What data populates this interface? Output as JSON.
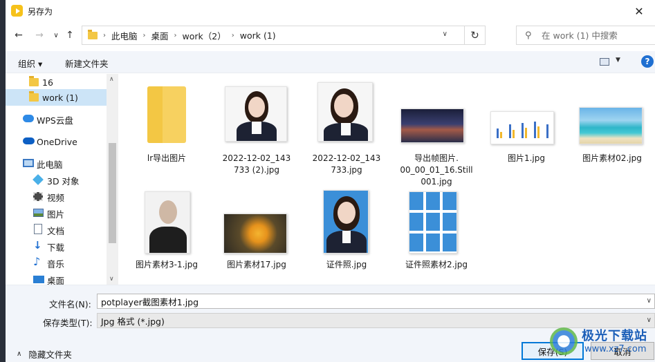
{
  "window": {
    "title": "另存为",
    "close_glyph": "✕"
  },
  "nav": {
    "back": "←",
    "forward": "→",
    "recent": "∨",
    "up": "↑",
    "breadcrumbs": [
      "此电脑",
      "桌面",
      "work（2）",
      "work (1)"
    ],
    "refresh": "↻",
    "search_placeholder": "在 work (1) 中搜索"
  },
  "toolbar": {
    "organize": "组织 ▾",
    "new_folder": "新建文件夹",
    "help": "?"
  },
  "sidebar": {
    "items": [
      {
        "label": "16",
        "icon": "folder-icon"
      },
      {
        "label": "work (1)",
        "icon": "folder-icon",
        "selected": true
      },
      {
        "label": "WPS云盘",
        "icon": "cloud-icon"
      },
      {
        "label": "OneDrive",
        "icon": "onedrive-icon"
      },
      {
        "label": "此电脑",
        "icon": "computer-icon"
      },
      {
        "label": "3D 对象",
        "icon": "cube-icon"
      },
      {
        "label": "视频",
        "icon": "video-icon"
      },
      {
        "label": "图片",
        "icon": "picture-icon"
      },
      {
        "label": "文档",
        "icon": "document-icon"
      },
      {
        "label": "下载",
        "icon": "download-icon"
      },
      {
        "label": "音乐",
        "icon": "music-icon"
      },
      {
        "label": "桌面",
        "icon": "desktop-icon"
      }
    ]
  },
  "files": [
    {
      "name": "lr导出图片",
      "type": "folder"
    },
    {
      "name": "2022-12-02_143733 (2).jpg",
      "type": "portrait"
    },
    {
      "name": "2022-12-02_143733.jpg",
      "type": "portrait"
    },
    {
      "name": "导出帧图片.00_00_01_16.Still001.jpg",
      "type": "city"
    },
    {
      "name": "图片1.jpg",
      "type": "chart"
    },
    {
      "name": "图片素材02.jpg",
      "type": "beach"
    },
    {
      "name": "图片素材3-1.jpg",
      "type": "elder"
    },
    {
      "name": "图片素材17.jpg",
      "type": "leaf"
    },
    {
      "name": "证件照.jpg",
      "type": "idphoto"
    },
    {
      "name": "证件照素材2.jpg",
      "type": "idgrid"
    }
  ],
  "file_lines": [
    [
      "lr导出图片"
    ],
    [
      "2022-12-02_143",
      "733 (2).jpg"
    ],
    [
      "2022-12-02_143",
      "733.jpg"
    ],
    [
      "导出帧图片.",
      "00_00_01_16.Still",
      "001.jpg"
    ],
    [
      "图片1.jpg"
    ],
    [
      "图片素材02.jpg"
    ],
    [
      "图片素材3-1.jpg"
    ],
    [
      "图片素材17.jpg"
    ],
    [
      "证件照.jpg"
    ],
    [
      "证件照素材2.jpg"
    ]
  ],
  "form": {
    "filename_label": "文件名(N):",
    "filename_value": "potplayer截图素材1.jpg",
    "filetype_label": "保存类型(T):",
    "filetype_value": "Jpg 格式 (*.jpg)"
  },
  "footer": {
    "hide_folders": "隐藏文件夹",
    "save": "保存(S)",
    "cancel": "取消"
  },
  "watermark": {
    "title": "极光下载站",
    "url": "www.xz7.com"
  },
  "colors": {
    "selected": "#cce4f7",
    "toolbar_bg": "#f2f5fa",
    "accent": "#0078d7",
    "folder": "#f3c744"
  }
}
